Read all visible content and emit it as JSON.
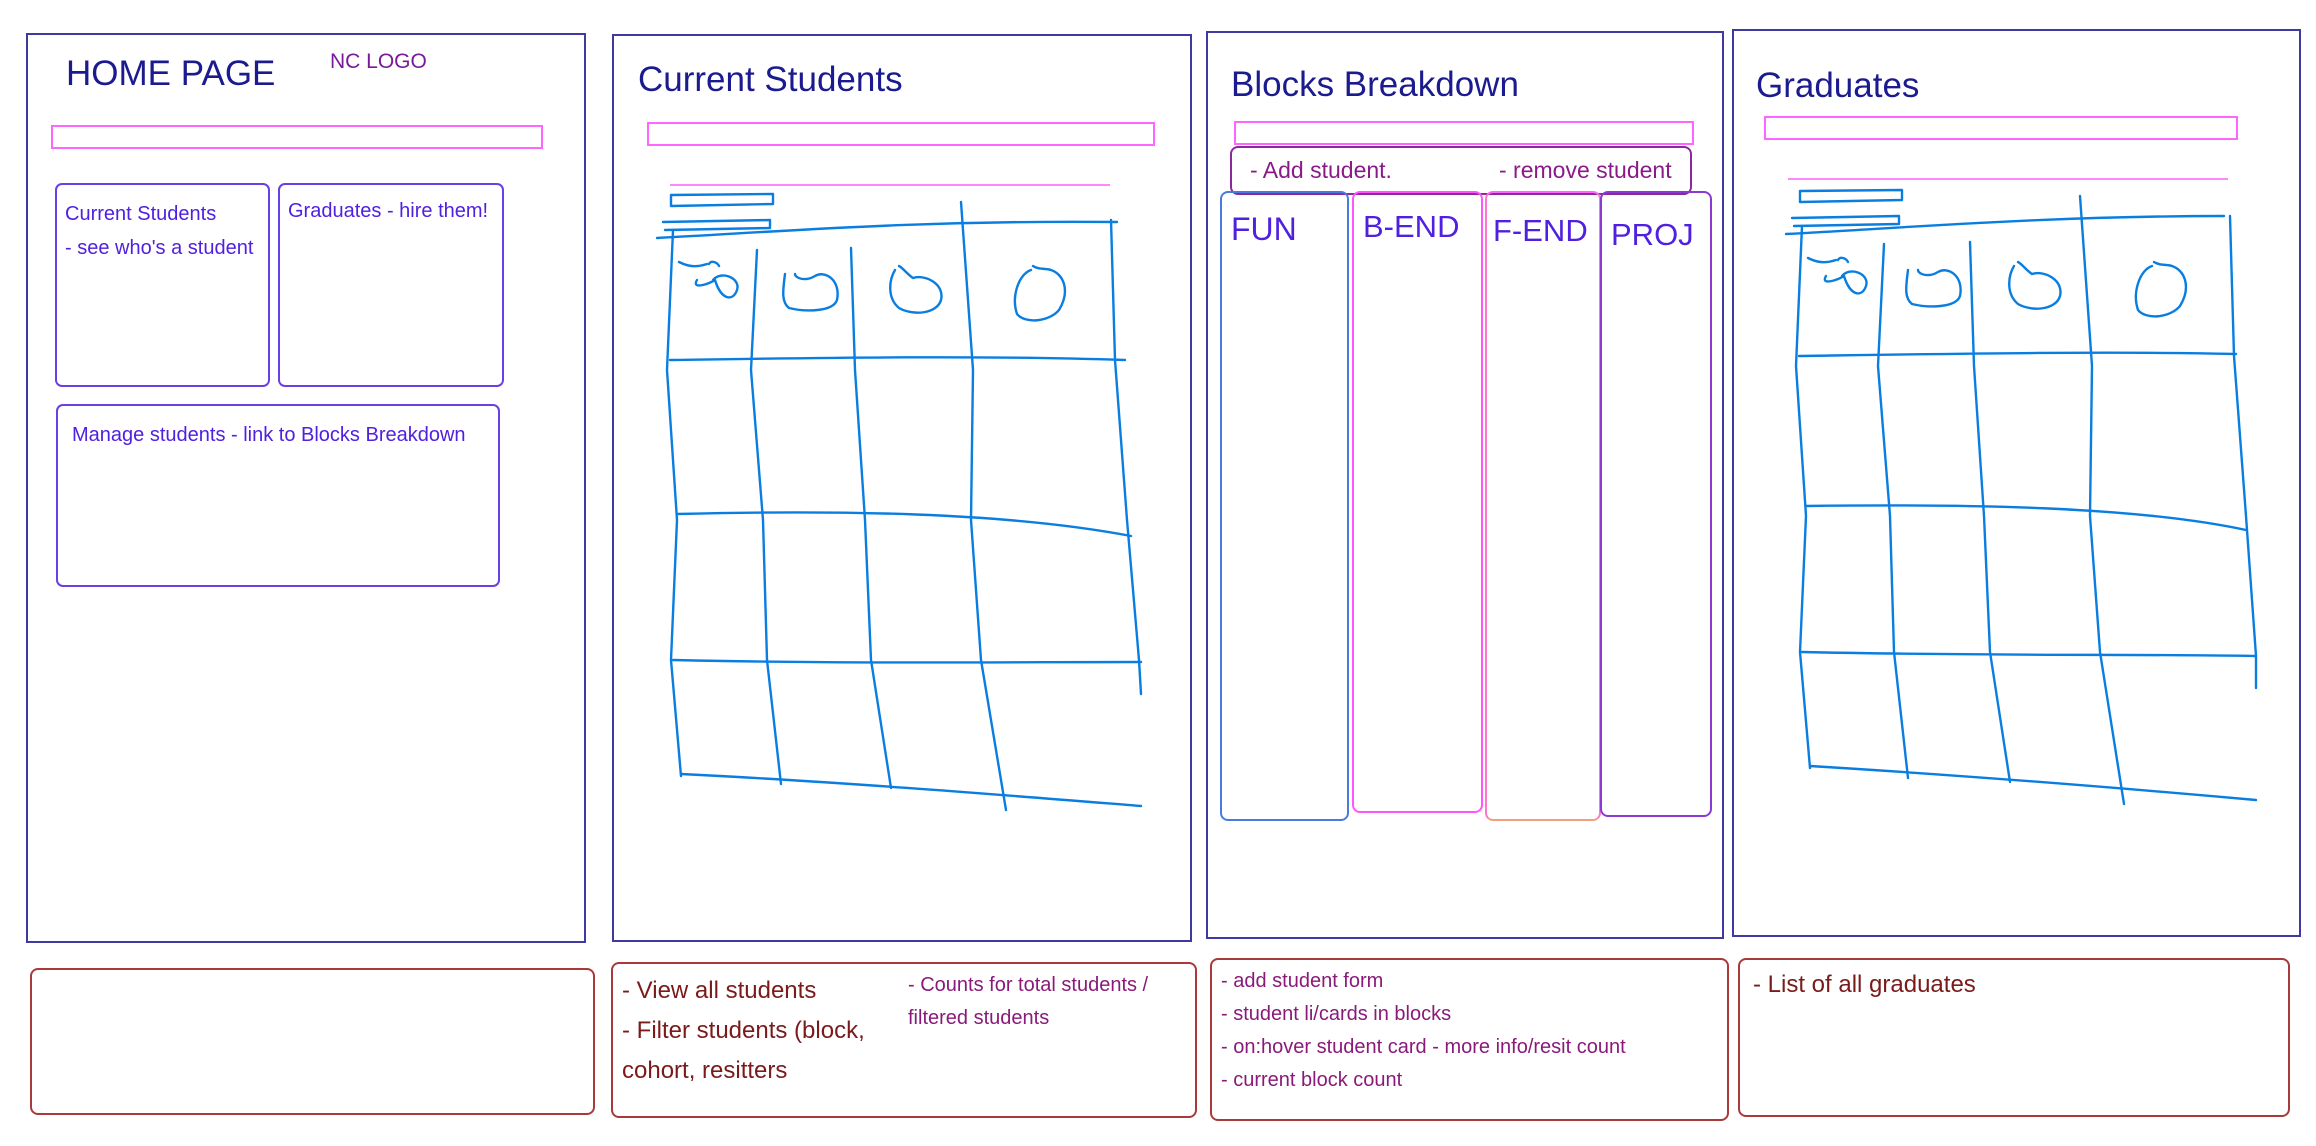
{
  "home": {
    "title": "HOME PAGE",
    "logo": "NC LOGO",
    "card_current_title": "Current Students",
    "card_current_sub": "- see who's a student",
    "card_graduates": "Graduates - hire them!",
    "card_manage": "Manage students - link to Blocks Breakdown"
  },
  "current": {
    "title": "Current Students",
    "note_lines": [
      "- View all students",
      "- Filter students (block,",
      "cohort, resitters"
    ],
    "note_side": [
      "- Counts for total students /",
      "filtered students"
    ]
  },
  "blocks": {
    "title": "Blocks Breakdown",
    "add_label": "- Add student.",
    "remove_label": "- remove student",
    "columns": [
      "FUN",
      "B-END",
      "F-END",
      "PROJ"
    ],
    "note_lines": [
      "- add student form",
      "- student li/cards in blocks",
      "- on:hover student card - more info/resit count",
      "- current block count"
    ]
  },
  "graduates": {
    "title": "Graduates",
    "note_lines": [
      "- List of all graduates"
    ]
  },
  "colors": {
    "frame_border": "#3f3aa0",
    "title_text": "#1b1b8f",
    "pink_bar": "#ff66ff",
    "card_text": "#5020e0",
    "sketch": "#0a7ee0",
    "note_border": "#a83a3a",
    "note_text": "#7a1a1a"
  }
}
